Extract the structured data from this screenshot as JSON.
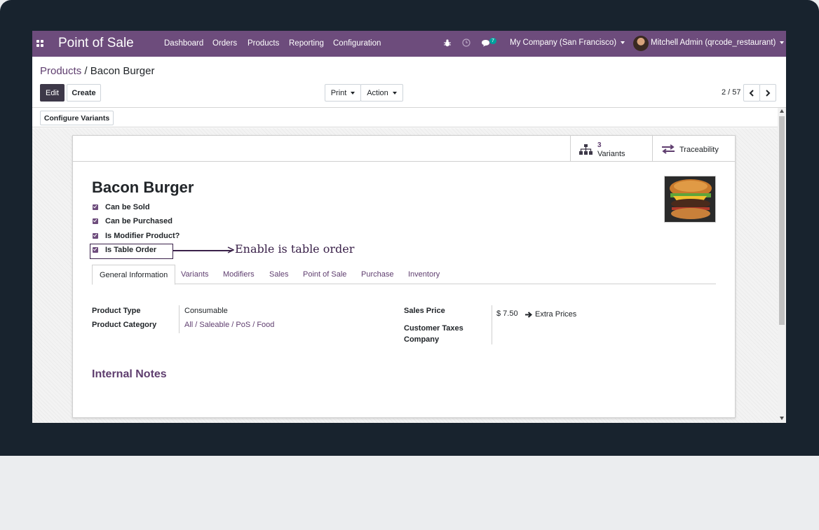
{
  "navbar": {
    "app_title": "Point of Sale",
    "menu": [
      "Dashboard",
      "Orders",
      "Products",
      "Reporting",
      "Configuration"
    ],
    "messages_count": "7",
    "company": "My Company (San Francisco)",
    "user": "Mitchell Admin (qrcode_restaurant)"
  },
  "breadcrumb": {
    "parent": "Products",
    "separator": " / ",
    "current": "Bacon Burger"
  },
  "toolbar": {
    "edit": "Edit",
    "create": "Create",
    "print": "Print",
    "action": "Action",
    "pager": "2 / 57"
  },
  "statusbar": {
    "configure_variants": "Configure Variants"
  },
  "smart_buttons": {
    "variants_count": "3",
    "variants_label": "Variants",
    "traceability": "Traceability"
  },
  "product": {
    "name": "Bacon Burger",
    "checks": [
      "Can be Sold",
      "Can be Purchased",
      "Is Modifier Product?",
      "Is Table Order"
    ]
  },
  "annotation": "Enable is table order",
  "tabs": [
    "General Information",
    "Variants",
    "Modifiers",
    "Sales",
    "Point of Sale",
    "Purchase",
    "Inventory"
  ],
  "fields": {
    "product_type_label": "Product Type",
    "product_type_value": "Consumable",
    "product_category_label": "Product Category",
    "product_category_value": "All / Saleable / PoS / Food",
    "sales_price_label": "Sales Price",
    "sales_price_value": "$ 7.50",
    "extra_prices": "Extra Prices",
    "customer_taxes_label": "Customer Taxes",
    "company_label": "Company"
  },
  "internal_notes_title": "Internal Notes",
  "colors": {
    "brand": "#6d4c7c",
    "link": "#5f3e6f",
    "annotation": "#3a2149"
  }
}
